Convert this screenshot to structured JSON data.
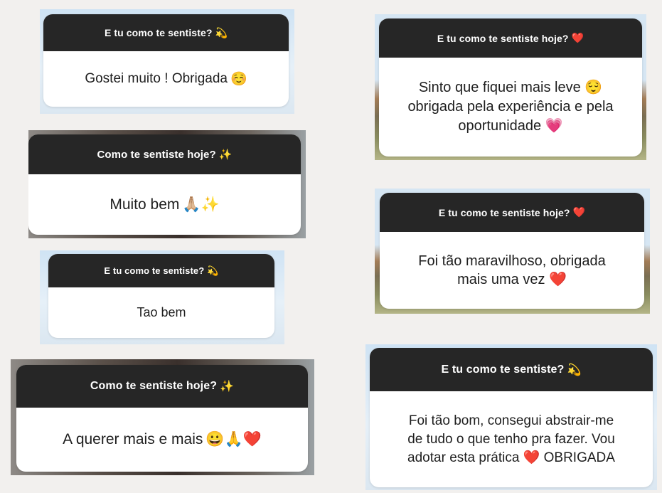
{
  "cards": [
    {
      "question": "E tu como te sentiste?",
      "q_emoji": "💫",
      "answer": "Gostei muito ! Obrigada",
      "a_emoji": "☺️"
    },
    {
      "question": "Como te sentiste hoje?",
      "q_emoji": "✨",
      "answer": "Muito bem",
      "a_emoji": "🙏🏼✨"
    },
    {
      "question": "E tu como te sentiste?",
      "q_emoji": "💫",
      "answer": "Tao bem",
      "a_emoji": ""
    },
    {
      "question": "Como te sentiste hoje?",
      "q_emoji": "✨",
      "answer": "A querer mais e mais",
      "a_emoji": "😀🙏❤️"
    },
    {
      "question": "E tu como te sentiste hoje?",
      "q_emoji": "❤️",
      "answer_lines": [
        "Sinto que fiquei mais leve 😌",
        "obrigada pela experiência e pela",
        "oportunidade 💗"
      ]
    },
    {
      "question": "E tu como te sentiste hoje?",
      "q_emoji": "❤️",
      "answer_lines": [
        "Foi tão maravilhoso, obrigada",
        "mais uma vez ❤️"
      ]
    },
    {
      "question": "E tu como te sentiste?",
      "q_emoji": "💫",
      "answer_lines": [
        "Foi tão bom, consegui abstrair-me",
        "de tudo o que tenho pra fazer. Vou",
        "adotar esta prática ❤️ OBRIGADA"
      ]
    }
  ]
}
